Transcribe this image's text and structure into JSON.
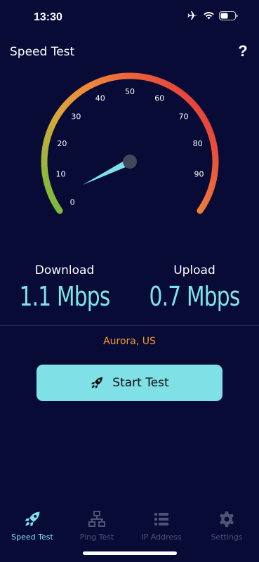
{
  "status_bar": {
    "time": "13:30",
    "icons": [
      "airplane-icon",
      "wifi-icon",
      "battery-icon"
    ]
  },
  "header": {
    "title": "Speed Test",
    "help_label": "?"
  },
  "gauge": {
    "tick_labels": [
      "0",
      "10",
      "20",
      "30",
      "40",
      "50",
      "60",
      "70",
      "80",
      "90"
    ],
    "min": 0,
    "max": 100,
    "needle_value": 3.5,
    "colors": [
      "#6cbf3a",
      "#e2a13a",
      "#f07a3a",
      "#e8443a"
    ]
  },
  "metrics": {
    "download_label": "Download",
    "download_value": "1.1 Mbps",
    "upload_label": "Upload",
    "upload_value": "0.7 Mbps"
  },
  "location": "Aurora, US",
  "start_button": {
    "label": "Start Test",
    "icon": "rocket-icon"
  },
  "tabs": [
    {
      "label": "Speed Test",
      "icon": "rocket-icon",
      "active": true
    },
    {
      "label": "Ping Test",
      "icon": "network-icon",
      "active": false
    },
    {
      "label": "IP Address",
      "icon": "list-icon",
      "active": false
    },
    {
      "label": "Settings",
      "icon": "gear-icon",
      "active": false
    }
  ],
  "colors": {
    "background": "#070b36",
    "accent": "#7fe0e6",
    "location": "#f59a33",
    "inactive_tab": "#4f5473"
  }
}
